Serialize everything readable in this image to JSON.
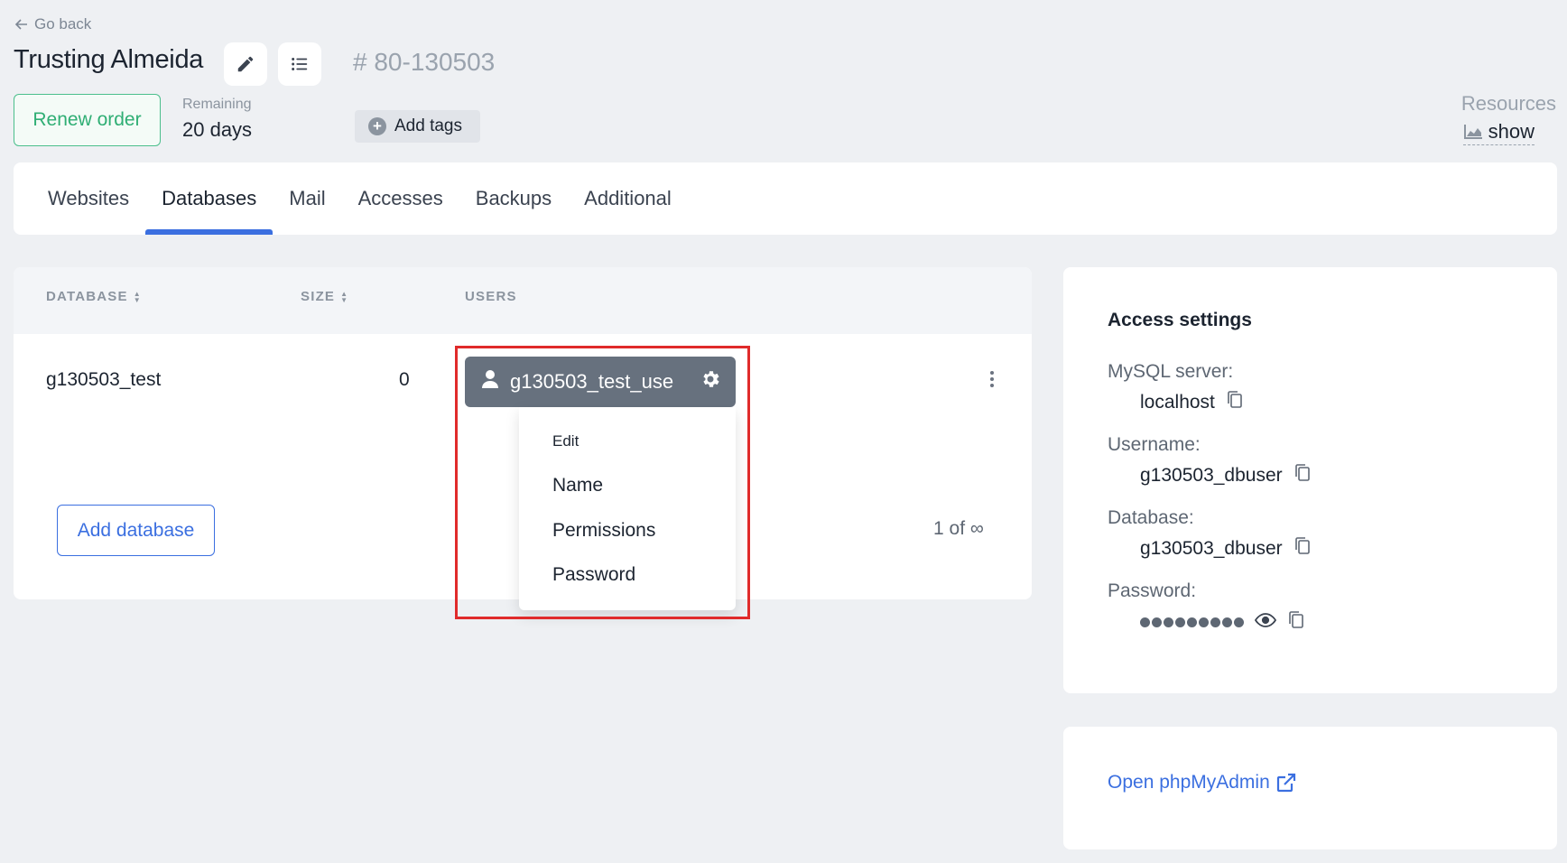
{
  "header": {
    "go_back": "Go back",
    "title": "Trusting Almeida",
    "order_number": "# 80-130503",
    "renew_label": "Renew order",
    "remaining_label": "Remaining",
    "remaining_value": "20 days",
    "add_tags_label": "Add tags",
    "resources_label": "Resources",
    "resources_show": "show"
  },
  "tabs": [
    {
      "label": "Websites"
    },
    {
      "label": "Databases",
      "active": true
    },
    {
      "label": "Mail"
    },
    {
      "label": "Accesses"
    },
    {
      "label": "Backups"
    },
    {
      "label": "Additional"
    }
  ],
  "table": {
    "columns": [
      "DATABASE",
      "SIZE",
      "USERS"
    ],
    "rows": [
      {
        "database": "g130503_test",
        "size": "0",
        "user": "g130503_test_use"
      }
    ],
    "add_database_label": "Add database",
    "pager": "1 of ∞"
  },
  "user_menu": {
    "header": "Edit",
    "items": [
      "Name",
      "Permissions",
      "Password"
    ]
  },
  "access_settings": {
    "title": "Access settings",
    "mysql_label": "MySQL server:",
    "mysql_value": "localhost",
    "username_label": "Username:",
    "username_value": "g130503_dbuser",
    "database_label": "Database:",
    "database_value": "g130503_dbuser",
    "password_label": "Password:"
  },
  "phpmyadmin": {
    "link_label": "Open phpMyAdmin"
  },
  "colors": {
    "accent": "#3b6fe0",
    "renew": "#2fae74",
    "highlight": "#e02b2b",
    "chip": "#67717e"
  }
}
